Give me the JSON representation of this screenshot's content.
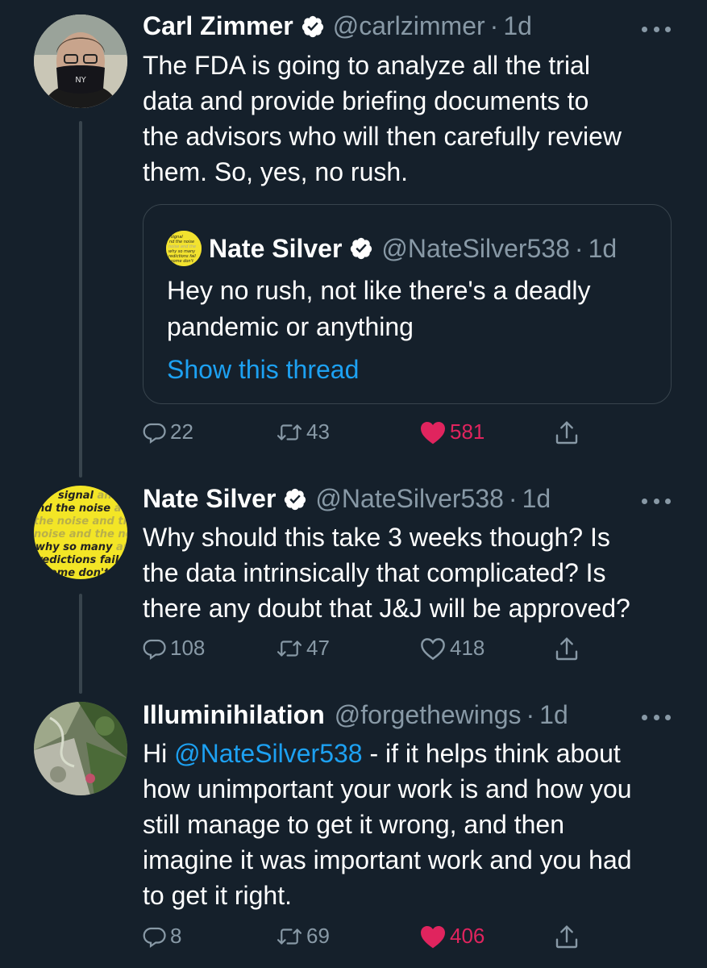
{
  "tweets": [
    {
      "name": "Carl Zimmer",
      "handle": "@carlzimmer",
      "dot": "·",
      "time": "1d",
      "text_lines": [
        "The FDA is going to analyze all the trial",
        "data and provide briefing documents to",
        "the advisors who will then carefully review",
        "them. So, yes, no rush."
      ],
      "quote": {
        "name": "Nate Silver",
        "handle": "@NateSilver538",
        "dot": "·",
        "time": "1d",
        "text_lines": [
          "Hey no rush, not like there's a deadly",
          "pandemic or anything"
        ],
        "link": "Show this thread"
      },
      "actions": {
        "replies": "22",
        "retweets": "43",
        "likes": "581",
        "liked": true
      }
    },
    {
      "name": "Nate Silver",
      "handle": "@NateSilver538",
      "dot": "·",
      "time": "1d",
      "avatar_text": [
        "signal and",
        "nd the noise a",
        "the noise and th",
        "noise and the no",
        "why so many and",
        "redictions fail",
        "some don't"
      ],
      "text_lines": [
        "Why should this take 3 weeks though? Is",
        "the data intrinsically that complicated? Is",
        "there any doubt that J&J will be approved?"
      ],
      "actions": {
        "replies": "108",
        "retweets": "47",
        "likes": "418",
        "liked": false
      }
    },
    {
      "name": "Illuminihilation",
      "handle": "@forgethewings",
      "dot": "·",
      "time": "1d",
      "text_first_pre": "Hi ",
      "text_mention": "@NateSilver538",
      "text_first_post": " - if it helps think about",
      "text_lines": [
        "how unimportant your work is and how you",
        "still manage to get it wrong, and then",
        "imagine it was important work and you had",
        "to get it right."
      ],
      "actions": {
        "replies": "8",
        "retweets": "69",
        "likes": "406",
        "liked": true
      }
    }
  ],
  "colors": {
    "background": "#15202b",
    "text": "#ffffff",
    "secondary": "#8899a6",
    "link": "#1da1f2",
    "like": "#e0245e",
    "border": "#38444d"
  },
  "icons": [
    "verified-badge-icon",
    "more-icon",
    "reply-icon",
    "retweet-icon",
    "like-icon",
    "share-icon"
  ]
}
